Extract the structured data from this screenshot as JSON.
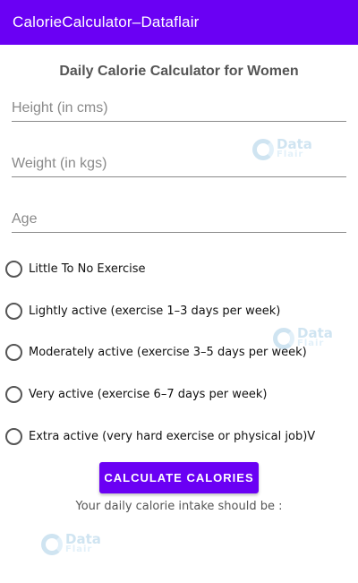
{
  "appbar": {
    "title": "CalorieCalculator–Dataflair"
  },
  "heading": "Daily Calorie Calculator for Women",
  "fields": {
    "height": {
      "placeholder": "Height (in cms)",
      "value": ""
    },
    "weight": {
      "placeholder": "Weight (in kgs)",
      "value": ""
    },
    "age": {
      "placeholder": "Age",
      "value": ""
    }
  },
  "activity_options": [
    {
      "label": "Little To No Exercise",
      "selected": false
    },
    {
      "label": "Lightly active (exercise 1–3 days per week)",
      "selected": false
    },
    {
      "label": "Moderately active (exercise 3–5 days per week)",
      "selected": false
    },
    {
      "label": "Very active (exercise 6–7 days per week)",
      "selected": false
    },
    {
      "label": "Extra active (very hard exercise or physical job)V",
      "selected": false
    }
  ],
  "button": {
    "label": "CALCULATE CALORIES"
  },
  "result": {
    "text": "Your daily calorie intake should be :"
  },
  "watermark": {
    "word": "Data",
    "sub": "Flair"
  },
  "colors": {
    "accent": "#6a00f4",
    "watermark": "#2a86c4"
  }
}
